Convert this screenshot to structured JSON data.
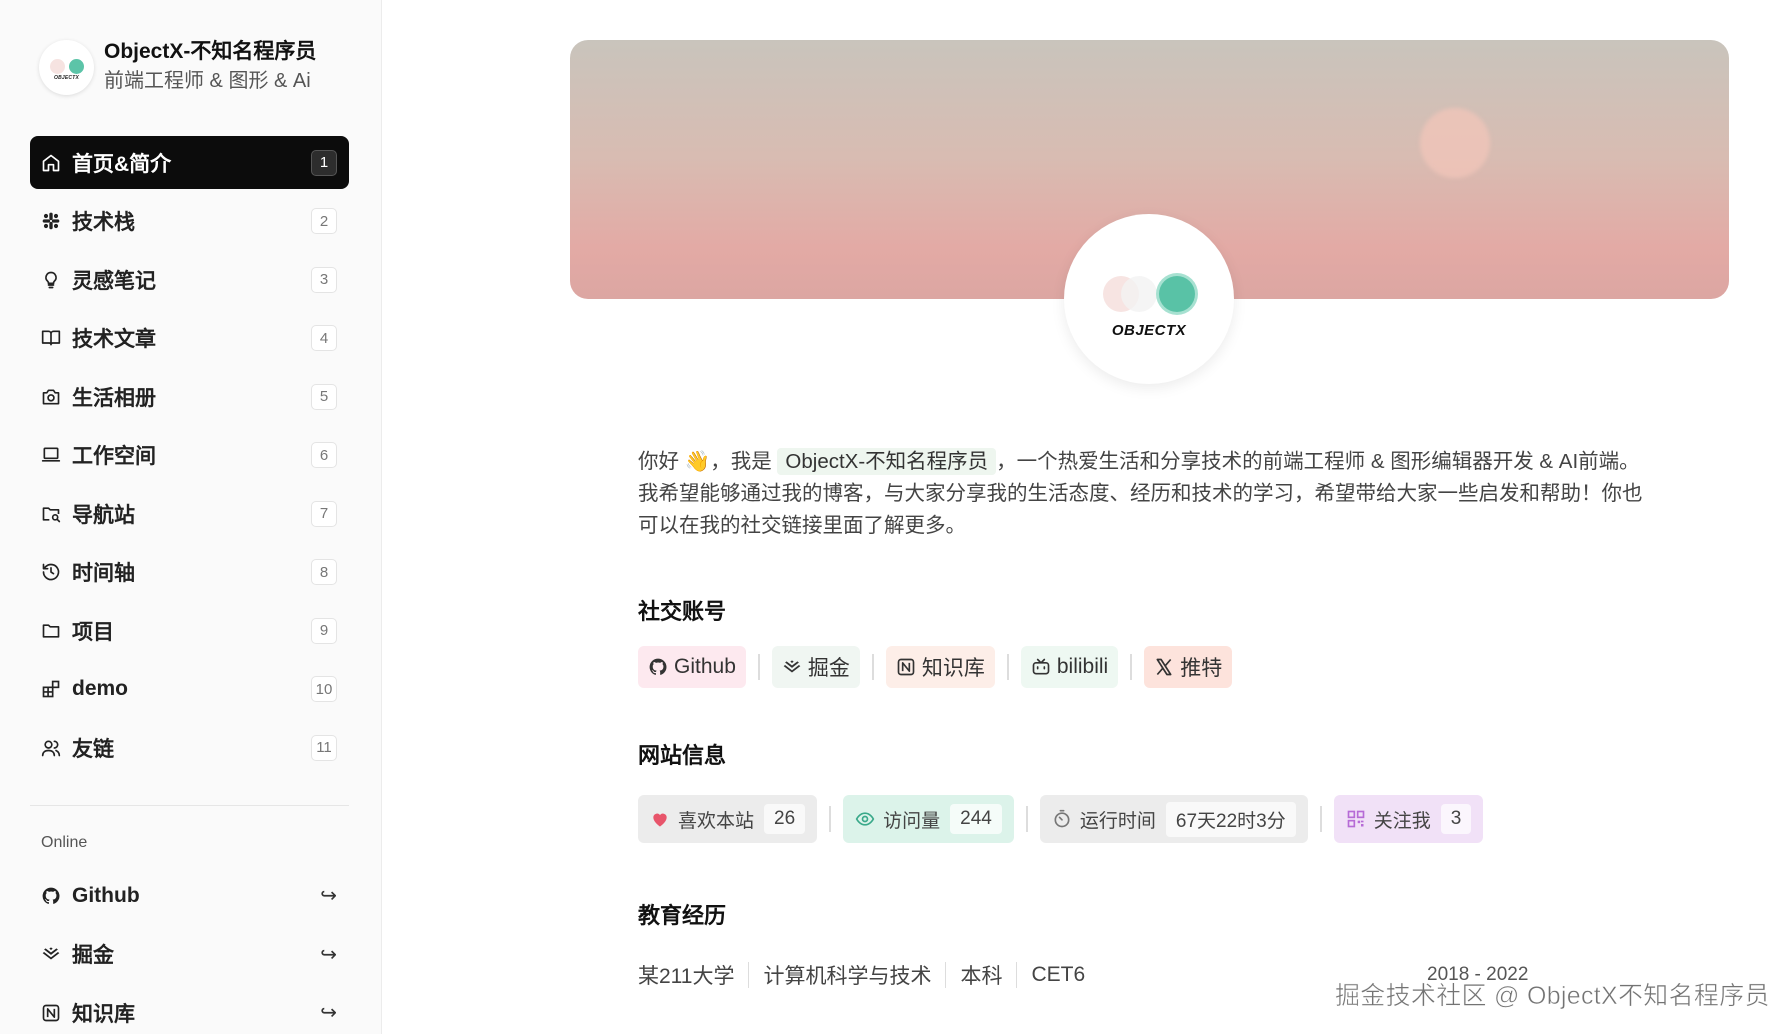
{
  "profile": {
    "name": "ObjectX-不知名程序员",
    "role": "前端工程师 & 图形 & Ai",
    "avatar_text": "OBJECTX"
  },
  "nav": [
    {
      "label": "首页&简介",
      "key": "1",
      "icon": "home-icon",
      "active": true
    },
    {
      "label": "技术栈",
      "key": "2",
      "icon": "slack-icon"
    },
    {
      "label": "灵感笔记",
      "key": "3",
      "icon": "lightbulb-icon"
    },
    {
      "label": "技术文章",
      "key": "4",
      "icon": "book-open-icon"
    },
    {
      "label": "生活相册",
      "key": "5",
      "icon": "camera-icon"
    },
    {
      "label": "工作空间",
      "key": "6",
      "icon": "laptop-icon"
    },
    {
      "label": "导航站",
      "key": "7",
      "icon": "folder-search-icon"
    },
    {
      "label": "时间轴",
      "key": "8",
      "icon": "history-icon"
    },
    {
      "label": "项目",
      "key": "9",
      "icon": "folder-icon"
    },
    {
      "label": "demo",
      "key": "10",
      "icon": "blocks-icon"
    },
    {
      "label": "友链",
      "key": "11",
      "icon": "users-icon"
    }
  ],
  "online": {
    "title": "Online",
    "items": [
      {
        "label": "Github",
        "icon": "github-icon"
      },
      {
        "label": "掘金",
        "icon": "juejin-icon"
      },
      {
        "label": "知识库",
        "icon": "notion-icon"
      }
    ],
    "arrow": "↪"
  },
  "intro": {
    "before": "你好 👋，我是 ",
    "highlight": "ObjectX-不知名程序员",
    "after": "，一个热爱生活和分享技术的前端工程师 & 图形编辑器开发 & AI前端。我希望能够通过我的博客，与大家分享我的生活态度、经历和技术的学习，希望带给大家一些启发和帮助！你也可以在我的社交链接里面了解更多。"
  },
  "social": {
    "title": "社交账号",
    "items": [
      {
        "label": "Github",
        "icon": "github-icon",
        "bg": "#fde9ef"
      },
      {
        "label": "掘金",
        "icon": "juejin-icon",
        "bg": "#f0f6f2"
      },
      {
        "label": "知识库",
        "icon": "notion-icon",
        "bg": "#fdeee8"
      },
      {
        "label": "bilibili",
        "icon": "bilibili-icon",
        "bg": "#eef8f2"
      },
      {
        "label": "推特",
        "icon": "x-icon",
        "bg": "#fde3dc"
      }
    ]
  },
  "site_info": {
    "title": "网站信息",
    "items": [
      {
        "label": "喜欢本站",
        "value": "26",
        "icon": "heart-icon",
        "bg": "#ececec"
      },
      {
        "label": "访问量",
        "value": "244",
        "icon": "eye-icon",
        "bg": "#dcf3ea"
      },
      {
        "label": "运行时间",
        "value": "67天22时3分",
        "icon": "timer-icon",
        "bg": "#ececec"
      },
      {
        "label": "关注我",
        "value": "3",
        "icon": "qrcode-icon",
        "bg": "#f1e1f7"
      }
    ]
  },
  "education": {
    "title": "教育经历",
    "school": "某211大学",
    "major": "计算机科学与技术",
    "degree": "本科",
    "cert": "CET6",
    "date": "2018 - 2022"
  },
  "watermark": "掘金技术社区 @ ObjectX不知名程序员",
  "colors": {
    "active_bg": "#0c0c0c",
    "heart": "#e8556b",
    "eye": "#3aa98a",
    "qrcode": "#b66bd6"
  }
}
